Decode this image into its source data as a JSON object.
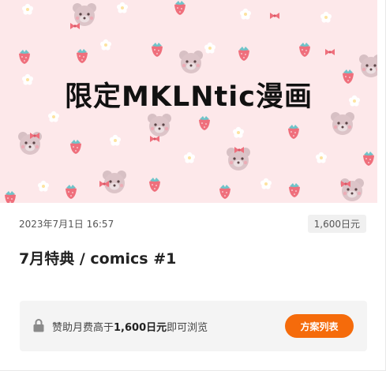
{
  "banner": {
    "title": "限定MKLNtic漫画",
    "background_color": "#fde8ea",
    "decorations": [
      "bear-icon",
      "strawberry-icon",
      "flower-icon",
      "ribbon-icon"
    ]
  },
  "post": {
    "date": "2023年7月1日 16:57",
    "price": "1,600日元",
    "title": "7月特典 / comics #1"
  },
  "lock_notice": {
    "icon": "lock-icon",
    "prefix": "赞助月费高于",
    "amount": "1,600日元",
    "suffix": "即可浏览"
  },
  "plans_button": {
    "label": "方案列表",
    "color": "#f56b0b"
  }
}
